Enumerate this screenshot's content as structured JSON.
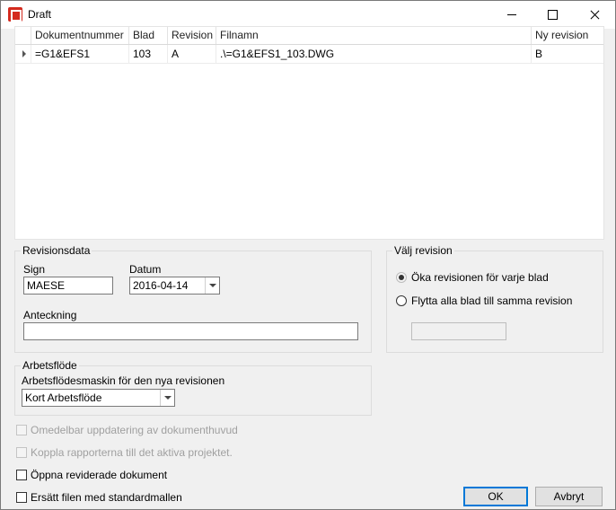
{
  "window": {
    "title": "Draft"
  },
  "grid": {
    "headers": [
      "Dokumentnummer",
      "Blad",
      "Revision",
      "Filnamn",
      "Ny revision"
    ],
    "rows": [
      {
        "dokumentnummer": "=G1&EFS1",
        "blad": "103",
        "revision": "A",
        "filnamn": ".\\=G1&EFS1_103.DWG",
        "ny_revision": "B"
      }
    ]
  },
  "revisionsdata": {
    "title": "Revisionsdata",
    "sign_label": "Sign",
    "sign_value": "MAESE",
    "datum_label": "Datum",
    "datum_value": "2016-04-14",
    "anteckning_label": "Anteckning",
    "anteckning_value": ""
  },
  "valj_revision": {
    "title": "Välj revision",
    "option1": "Öka revisionen för varje blad",
    "option2": "Flytta alla blad till samma revision",
    "selected": 1,
    "revision_value": ""
  },
  "arbetsflode": {
    "title": "Arbetsflöde",
    "machine_label": "Arbetsflödesmaskin för den nya revisionen",
    "machine_value": "Kort Arbetsflöde"
  },
  "options": {
    "update_header": "Omedelbar uppdatering av dokumenthuvud",
    "link_reports": "Koppla rapporterna till det aktiva projektet.",
    "open_revised": "Öppna reviderade dokument",
    "replace_file": "Ersätt filen med standardmallen"
  },
  "buttons": {
    "ok": "OK",
    "cancel": "Avbryt"
  }
}
